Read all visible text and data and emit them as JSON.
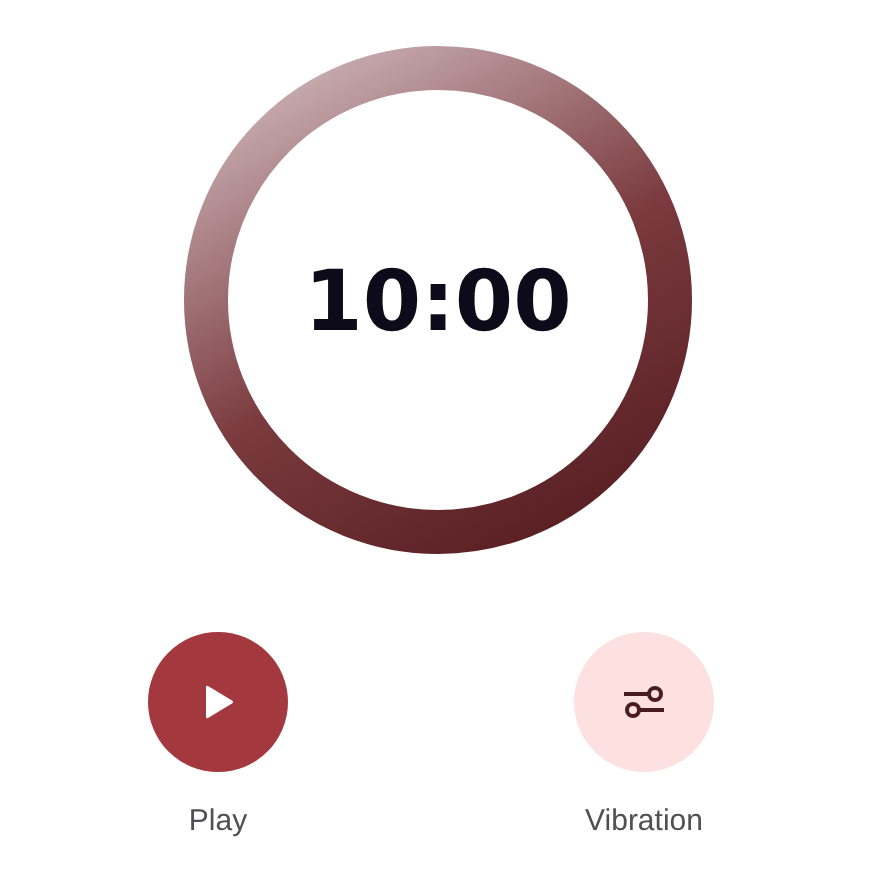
{
  "timer": {
    "time": "10:00"
  },
  "actions": [
    {
      "label": "Play",
      "kind": "play"
    },
    {
      "label": "Vibration",
      "kind": "tune"
    }
  ]
}
